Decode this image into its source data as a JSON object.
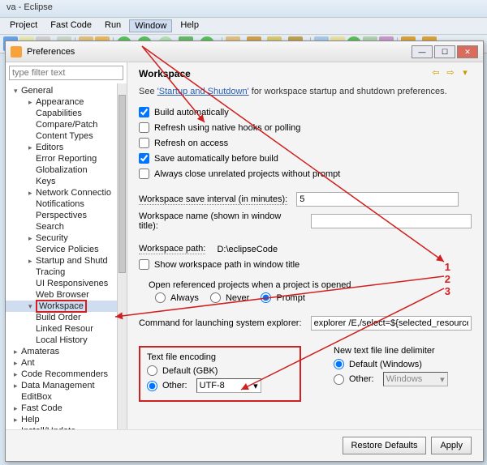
{
  "app_title": "va - Eclipse",
  "menubar": [
    "Project",
    "Fast Code",
    "Run",
    "Window",
    "Help"
  ],
  "dialog": {
    "title": "Preferences",
    "filter_placeholder": "type filter text",
    "tree": [
      {
        "l": 1,
        "exp": "▾",
        "label": "General"
      },
      {
        "l": 2,
        "exp": "▸",
        "label": "Appearance"
      },
      {
        "l": 2,
        "exp": "",
        "label": "Capabilities"
      },
      {
        "l": 2,
        "exp": "",
        "label": "Compare/Patch"
      },
      {
        "l": 2,
        "exp": "",
        "label": "Content Types"
      },
      {
        "l": 2,
        "exp": "▸",
        "label": "Editors"
      },
      {
        "l": 2,
        "exp": "",
        "label": "Error Reporting"
      },
      {
        "l": 2,
        "exp": "",
        "label": "Globalization"
      },
      {
        "l": 2,
        "exp": "",
        "label": "Keys"
      },
      {
        "l": 2,
        "exp": "▸",
        "label": "Network Connectio"
      },
      {
        "l": 2,
        "exp": "",
        "label": "Notifications"
      },
      {
        "l": 2,
        "exp": "",
        "label": "Perspectives"
      },
      {
        "l": 2,
        "exp": "",
        "label": "Search"
      },
      {
        "l": 2,
        "exp": "▸",
        "label": "Security"
      },
      {
        "l": 2,
        "exp": "",
        "label": "Service Policies"
      },
      {
        "l": 2,
        "exp": "▸",
        "label": "Startup and Shutd"
      },
      {
        "l": 2,
        "exp": "",
        "label": "Tracing"
      },
      {
        "l": 2,
        "exp": "",
        "label": "UI Responsivenes"
      },
      {
        "l": 2,
        "exp": "",
        "label": "Web Browser"
      },
      {
        "l": 2,
        "exp": "▾",
        "label": "Workspace",
        "selected": true
      },
      {
        "l": 2,
        "exp": "",
        "label": "Build Order"
      },
      {
        "l": 2,
        "exp": "",
        "label": "Linked Resour"
      },
      {
        "l": 2,
        "exp": "",
        "label": "Local History"
      },
      {
        "l": 1,
        "exp": "▸",
        "label": "Amateras"
      },
      {
        "l": 1,
        "exp": "▸",
        "label": "Ant"
      },
      {
        "l": 1,
        "exp": "▸",
        "label": "Code Recommenders"
      },
      {
        "l": 1,
        "exp": "▸",
        "label": "Data Management"
      },
      {
        "l": 1,
        "exp": "",
        "label": "EditBox"
      },
      {
        "l": 1,
        "exp": "▸",
        "label": "Fast Code"
      },
      {
        "l": 1,
        "exp": "▸",
        "label": "Help"
      },
      {
        "l": 1,
        "exp": "▸",
        "label": "Install/Undate"
      }
    ],
    "page_heading": "Workspace",
    "see_prefix": "See ",
    "see_link": "'Startup and Shutdown'",
    "see_suffix": " for workspace startup and shutdown preferences.",
    "checks": {
      "build_auto": {
        "label": "Build automatically",
        "checked": true
      },
      "refresh_native": {
        "label": "Refresh using native hooks or polling",
        "checked": false
      },
      "refresh_access": {
        "label": "Refresh on access",
        "checked": false
      },
      "save_before": {
        "label": "Save automatically before build",
        "checked": true
      },
      "close_unrelated": {
        "label": "Always close unrelated projects without prompt",
        "checked": false
      },
      "show_path": {
        "label": "Show workspace path in window title",
        "checked": false
      }
    },
    "save_interval_label": "Workspace save interval (in minutes):",
    "save_interval_value": "5",
    "ws_name_label": "Workspace name (shown in window title):",
    "ws_name_value": "",
    "ws_path_label": "Workspace path:",
    "ws_path_value": "D:\\eclipseCode",
    "open_ref_label": "Open referenced projects when a project is opened",
    "open_ref_options": {
      "always": "Always",
      "never": "Never",
      "prompt": "Prompt"
    },
    "open_ref_selected": "prompt",
    "cmd_label": "Command for launching system explorer:",
    "cmd_value": "explorer /E,/select=${selected_resource_loc}",
    "encoding": {
      "group_label": "Text file encoding",
      "default_label": "Default (GBK)",
      "other_label": "Other:",
      "other_value": "UTF-8",
      "selected": "other"
    },
    "delimiter": {
      "group_label": "New text file line delimiter",
      "default_label": "Default (Windows)",
      "other_label": "Other:",
      "other_value": "Windows",
      "selected": "default"
    },
    "buttons": {
      "restore": "Restore Defaults",
      "apply": "Apply"
    },
    "annotations": {
      "n1": "1",
      "n2": "2",
      "n3": "3"
    }
  }
}
